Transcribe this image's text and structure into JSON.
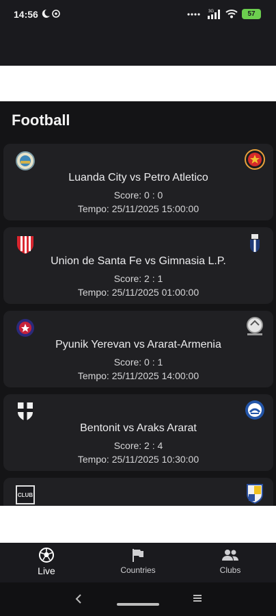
{
  "status_bar": {
    "time": "14:56",
    "network": "3G",
    "battery": "57"
  },
  "page": {
    "title": "Football"
  },
  "matches": [
    {
      "home": "Luanda City",
      "away": "Petro Atletico",
      "title": "Luanda City vs Petro Atletico",
      "score": "Score: 0 : 0",
      "time": "Tempo: 25/11/2025 15:00:00"
    },
    {
      "home": "Union de Santa Fe",
      "away": "Gimnasia L.P.",
      "title": "Union de Santa Fe vs Gimnasia L.P.",
      "score": "Score: 2 : 1",
      "time": "Tempo: 25/11/2025 01:00:00"
    },
    {
      "home": "Pyunik Yerevan",
      "away": "Ararat-Armenia",
      "title": "Pyunik Yerevan vs Ararat-Armenia",
      "score": "Score: 0 : 1",
      "time": "Tempo: 25/11/2025 14:00:00"
    },
    {
      "home": "Bentonit",
      "away": "Araks Ararat",
      "title": "Bentonit vs Araks Ararat",
      "score": "Score: 2 : 4",
      "time": "Tempo: 25/11/2025 10:30:00"
    },
    {
      "home_logo_text": "CLUB"
    }
  ],
  "bottom_nav": {
    "items": [
      {
        "label": "Live",
        "icon": "soccer-ball-icon",
        "active": true
      },
      {
        "label": "Countries",
        "icon": "flag-icon",
        "active": false
      },
      {
        "label": "Clubs",
        "icon": "people-icon",
        "active": false
      }
    ]
  },
  "colors": {
    "background": "#141416",
    "card": "#202023",
    "text": "#ececee",
    "battery": "#6ccf4f"
  }
}
